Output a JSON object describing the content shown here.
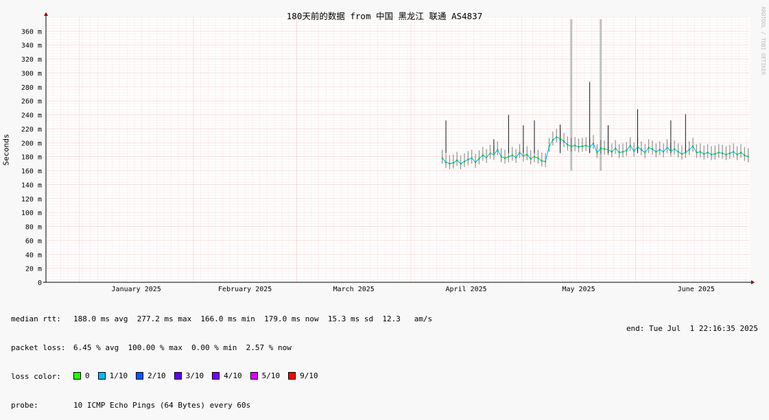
{
  "title": "180天前的数据 from 中国 黑龙江 联通 AS4837",
  "ylabel": "Seconds",
  "watermark": "RRDTOOL / TOBI OETIKER",
  "chart_data": {
    "type": "line",
    "title": "180天前的数据 from 中国 黑龙江 联通 AS4837",
    "ylabel": "Seconds",
    "xlabel": "",
    "ylim": [
      0,
      380
    ],
    "y_unit": "ms",
    "yticks": [
      0,
      20,
      40,
      60,
      80,
      100,
      120,
      140,
      160,
      180,
      200,
      220,
      240,
      260,
      280,
      300,
      320,
      340,
      360
    ],
    "ytick_labels": [
      "0",
      "20 m",
      "40 m",
      "60 m",
      "80 m",
      "100 m",
      "120 m",
      "140 m",
      "160 m",
      "180 m",
      "200 m",
      "220 m",
      "240 m",
      "260 m",
      "280 m",
      "300 m",
      "320 m",
      "340 m",
      "360 m"
    ],
    "xlim": [
      "2024-12-23",
      "2025-07-01"
    ],
    "xticks": [
      "2025-01-01",
      "2025-02-01",
      "2025-03-01",
      "2025-04-01",
      "2025-05-01",
      "2025-06-01"
    ],
    "xtick_labels": [
      "January 2025",
      "February 2025",
      "March 2025",
      "April 2025",
      "May 2025",
      "June 2025"
    ],
    "grid": true,
    "series": [
      {
        "name": "median rtt",
        "color": "#00c000",
        "x": [
          "2025-04-09",
          "2025-04-10",
          "2025-04-11",
          "2025-04-12",
          "2025-04-13",
          "2025-04-14",
          "2025-04-15",
          "2025-04-16",
          "2025-04-17",
          "2025-04-18",
          "2025-04-19",
          "2025-04-20",
          "2025-04-21",
          "2025-04-22",
          "2025-04-23",
          "2025-04-24",
          "2025-04-25",
          "2025-04-26",
          "2025-04-27",
          "2025-04-28",
          "2025-04-29",
          "2025-04-30",
          "2025-05-01",
          "2025-05-02",
          "2025-05-03",
          "2025-05-04",
          "2025-05-05",
          "2025-05-06",
          "2025-05-07",
          "2025-05-08",
          "2025-05-09",
          "2025-05-10",
          "2025-05-11",
          "2025-05-12",
          "2025-05-13",
          "2025-05-14",
          "2025-05-15",
          "2025-05-16",
          "2025-05-17",
          "2025-05-18",
          "2025-05-19",
          "2025-05-20",
          "2025-05-21",
          "2025-05-22",
          "2025-05-23",
          "2025-05-24",
          "2025-05-25",
          "2025-05-26",
          "2025-05-27",
          "2025-05-28",
          "2025-05-29",
          "2025-05-30",
          "2025-05-31",
          "2025-06-01",
          "2025-06-02",
          "2025-06-03",
          "2025-06-04",
          "2025-06-05",
          "2025-06-06",
          "2025-06-07",
          "2025-06-08",
          "2025-06-09",
          "2025-06-10",
          "2025-06-11",
          "2025-06-12",
          "2025-06-13",
          "2025-06-14",
          "2025-06-15",
          "2025-06-16",
          "2025-06-17",
          "2025-06-18",
          "2025-06-19",
          "2025-06-20",
          "2025-06-21",
          "2025-06-22",
          "2025-06-23",
          "2025-06-24",
          "2025-06-25",
          "2025-06-26",
          "2025-06-27",
          "2025-06-28",
          "2025-06-29",
          "2025-06-30",
          "2025-07-01"
        ],
        "values": [
          178,
          172,
          170,
          171,
          175,
          170,
          173,
          176,
          178,
          172,
          177,
          182,
          179,
          185,
          183,
          190,
          180,
          178,
          180,
          182,
          179,
          186,
          181,
          183,
          177,
          180,
          178,
          174,
          173,
          195,
          204,
          208,
          206,
          202,
          197,
          195,
          196,
          194,
          195,
          196,
          194,
          199,
          186,
          192,
          191,
          190,
          187,
          192,
          186,
          187,
          189,
          196,
          188,
          194,
          190,
          186,
          193,
          191,
          187,
          190,
          187,
          193,
          188,
          191,
          187,
          184,
          186,
          190,
          195,
          186,
          187,
          184,
          186,
          183,
          184,
          186,
          185,
          183,
          185,
          187,
          183,
          186,
          182,
          180
        ]
      }
    ],
    "spikes": [
      {
        "x": "2025-04-10",
        "value": 232
      },
      {
        "x": "2025-04-23",
        "value": 205
      },
      {
        "x": "2025-04-27",
        "value": 240
      },
      {
        "x": "2025-05-01",
        "value": 225
      },
      {
        "x": "2025-05-04",
        "value": 232
      },
      {
        "x": "2025-05-11",
        "value": 226
      },
      {
        "x": "2025-05-19",
        "value": 287
      },
      {
        "x": "2025-05-24",
        "value": 225
      },
      {
        "x": "2025-06-01",
        "value": 248
      },
      {
        "x": "2025-06-10",
        "value": 232
      },
      {
        "x": "2025-06-14",
        "value": 241
      }
    ],
    "loss_markers": [
      {
        "x": "2025-05-14",
        "color": "#c0c0c0"
      },
      {
        "x": "2025-05-22",
        "color": "#c0c0c0"
      }
    ]
  },
  "stats": {
    "rtt_label": "median rtt:",
    "rtt_value": "188.0 ms avg  277.2 ms max  166.0 ms min  179.0 ms now  15.3 ms sd  12.3   am/s",
    "loss_label": "packet loss:",
    "loss_value": "6.45 % avg  100.00 % max  0.00 % min  2.57 % now",
    "color_label": "loss color:",
    "loss_colors": [
      {
        "label": "0",
        "color": "#26ff00"
      },
      {
        "label": "1/10",
        "color": "#00b8ff"
      },
      {
        "label": "2/10",
        "color": "#0059ff"
      },
      {
        "label": "3/10",
        "color": "#5e00ff"
      },
      {
        "label": "4/10",
        "color": "#7e00ff"
      },
      {
        "label": "5/10",
        "color": "#dd00ff"
      },
      {
        "label": "9/10",
        "color": "#ff0000"
      }
    ],
    "probe_label": "probe:",
    "probe_value": "10 ICMP Echo Pings (64 Bytes) every 60s",
    "end_text": "end: Tue Jul  1 22:16:35 2025"
  }
}
